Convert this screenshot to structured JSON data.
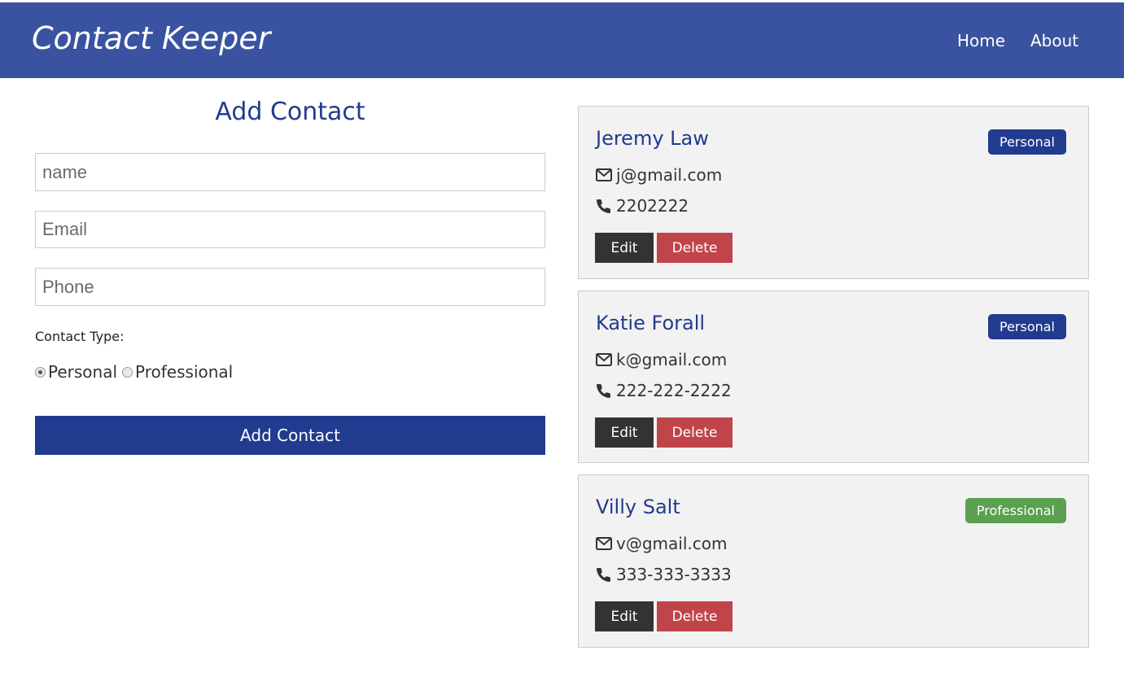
{
  "app": {
    "brand": "Contact Keeper"
  },
  "nav": {
    "home": "Home",
    "about": "About"
  },
  "form": {
    "title": "Add Contact",
    "name_placeholder": "name",
    "email_placeholder": "Email",
    "phone_placeholder": "Phone",
    "type_label": "Contact Type:",
    "type_options": [
      {
        "label": "Personal",
        "checked": true
      },
      {
        "label": "Professional",
        "checked": false
      }
    ],
    "submit_label": "Add Contact"
  },
  "contacts": [
    {
      "name": "Jeremy Law",
      "email": "j@gmail.com",
      "phone": "2202222",
      "type": "Personal",
      "type_color": "#213b8f",
      "edit_label": "Edit",
      "delete_label": "Delete"
    },
    {
      "name": "Katie Forall",
      "email": "k@gmail.com",
      "phone": "222-222-2222",
      "type": "Personal",
      "type_color": "#213b8f",
      "edit_label": "Edit",
      "delete_label": "Delete"
    },
    {
      "name": "Villy Salt",
      "email": "v@gmail.com",
      "phone": "333-333-3333",
      "type": "Professional",
      "type_color": "#5aa04f",
      "edit_label": "Edit",
      "delete_label": "Delete"
    }
  ],
  "colors": {
    "navbar": "#3a53a0",
    "primary": "#213b8f",
    "success": "#5aa04f",
    "danger": "#c0444a",
    "dark": "#333333",
    "card_bg": "#f2f2f2"
  },
  "icons": {
    "email": "envelope-icon",
    "phone": "phone-icon"
  }
}
